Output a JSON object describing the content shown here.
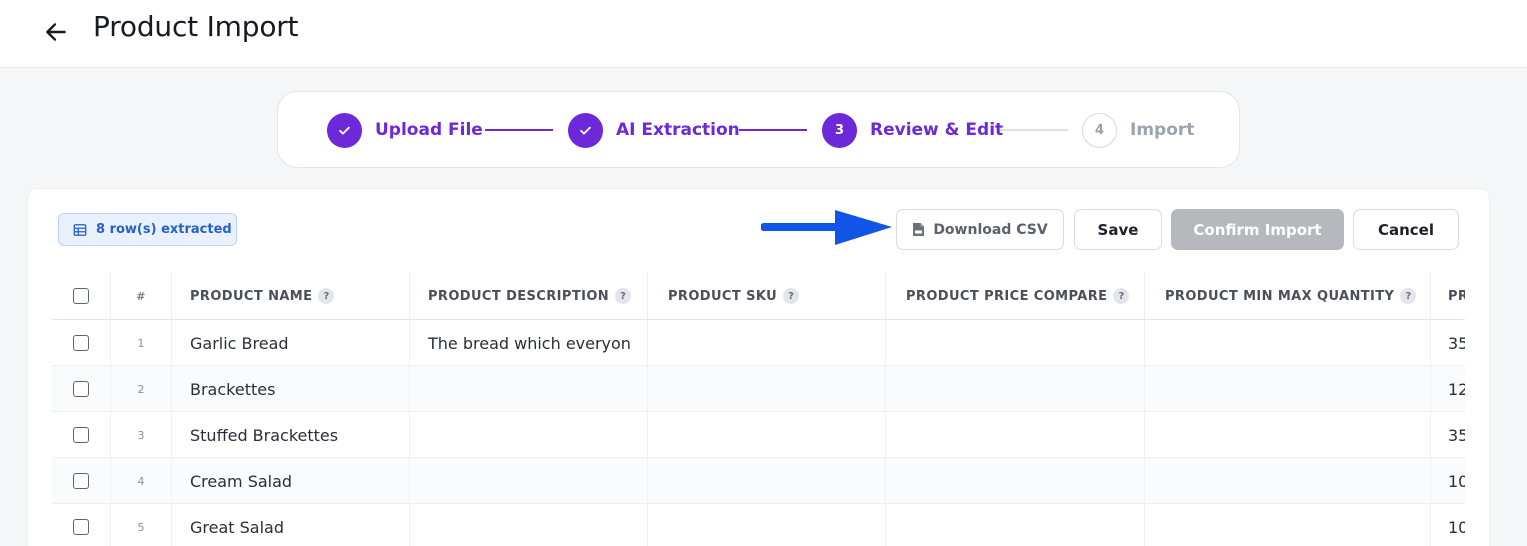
{
  "header": {
    "title": "Product Import",
    "back_icon": "arrow-left-icon"
  },
  "stepper": {
    "steps": [
      {
        "label": "Upload File",
        "state": "done",
        "badge": ""
      },
      {
        "label": "AI Extraction",
        "state": "done",
        "badge": ""
      },
      {
        "label": "Review & Edit",
        "state": "active",
        "badge": "3"
      },
      {
        "label": "Import",
        "state": "todo",
        "badge": "4"
      }
    ]
  },
  "toolbar": {
    "rows_badge": "8 row(s) extracted",
    "download_csv_label": "Download CSV",
    "save_label": "Save",
    "confirm_label": "Confirm Import",
    "cancel_label": "Cancel"
  },
  "table": {
    "columns": {
      "num": "#",
      "name": "PRODUCT NAME",
      "description": "PRODUCT DESCRIPTION",
      "sku": "PRODUCT SKU",
      "compare": "PRODUCT PRICE COMPARE",
      "minmax": "PRODUCT MIN MAX QUANTITY",
      "price": "PR"
    },
    "help_glyph": "?",
    "rows": [
      {
        "num": "1",
        "name": "Garlic Bread",
        "description": "The bread which everyon",
        "sku": "",
        "compare": "",
        "minmax": "",
        "price": "35"
      },
      {
        "num": "2",
        "name": "Brackettes",
        "description": "",
        "sku": "",
        "compare": "",
        "minmax": "",
        "price": "12"
      },
      {
        "num": "3",
        "name": "Stuffed Brackettes",
        "description": "",
        "sku": "",
        "compare": "",
        "minmax": "",
        "price": "35"
      },
      {
        "num": "4",
        "name": "Cream Salad",
        "description": "",
        "sku": "",
        "compare": "",
        "minmax": "",
        "price": "10"
      },
      {
        "num": "5",
        "name": "Great Salad",
        "description": "",
        "sku": "",
        "compare": "",
        "minmax": "",
        "price": "10"
      }
    ]
  },
  "colors": {
    "accent": "#6d28d9",
    "badge_blue": "#2860c8",
    "annotation_arrow": "#1155e6",
    "disabled_button": "#b6b8bd"
  }
}
